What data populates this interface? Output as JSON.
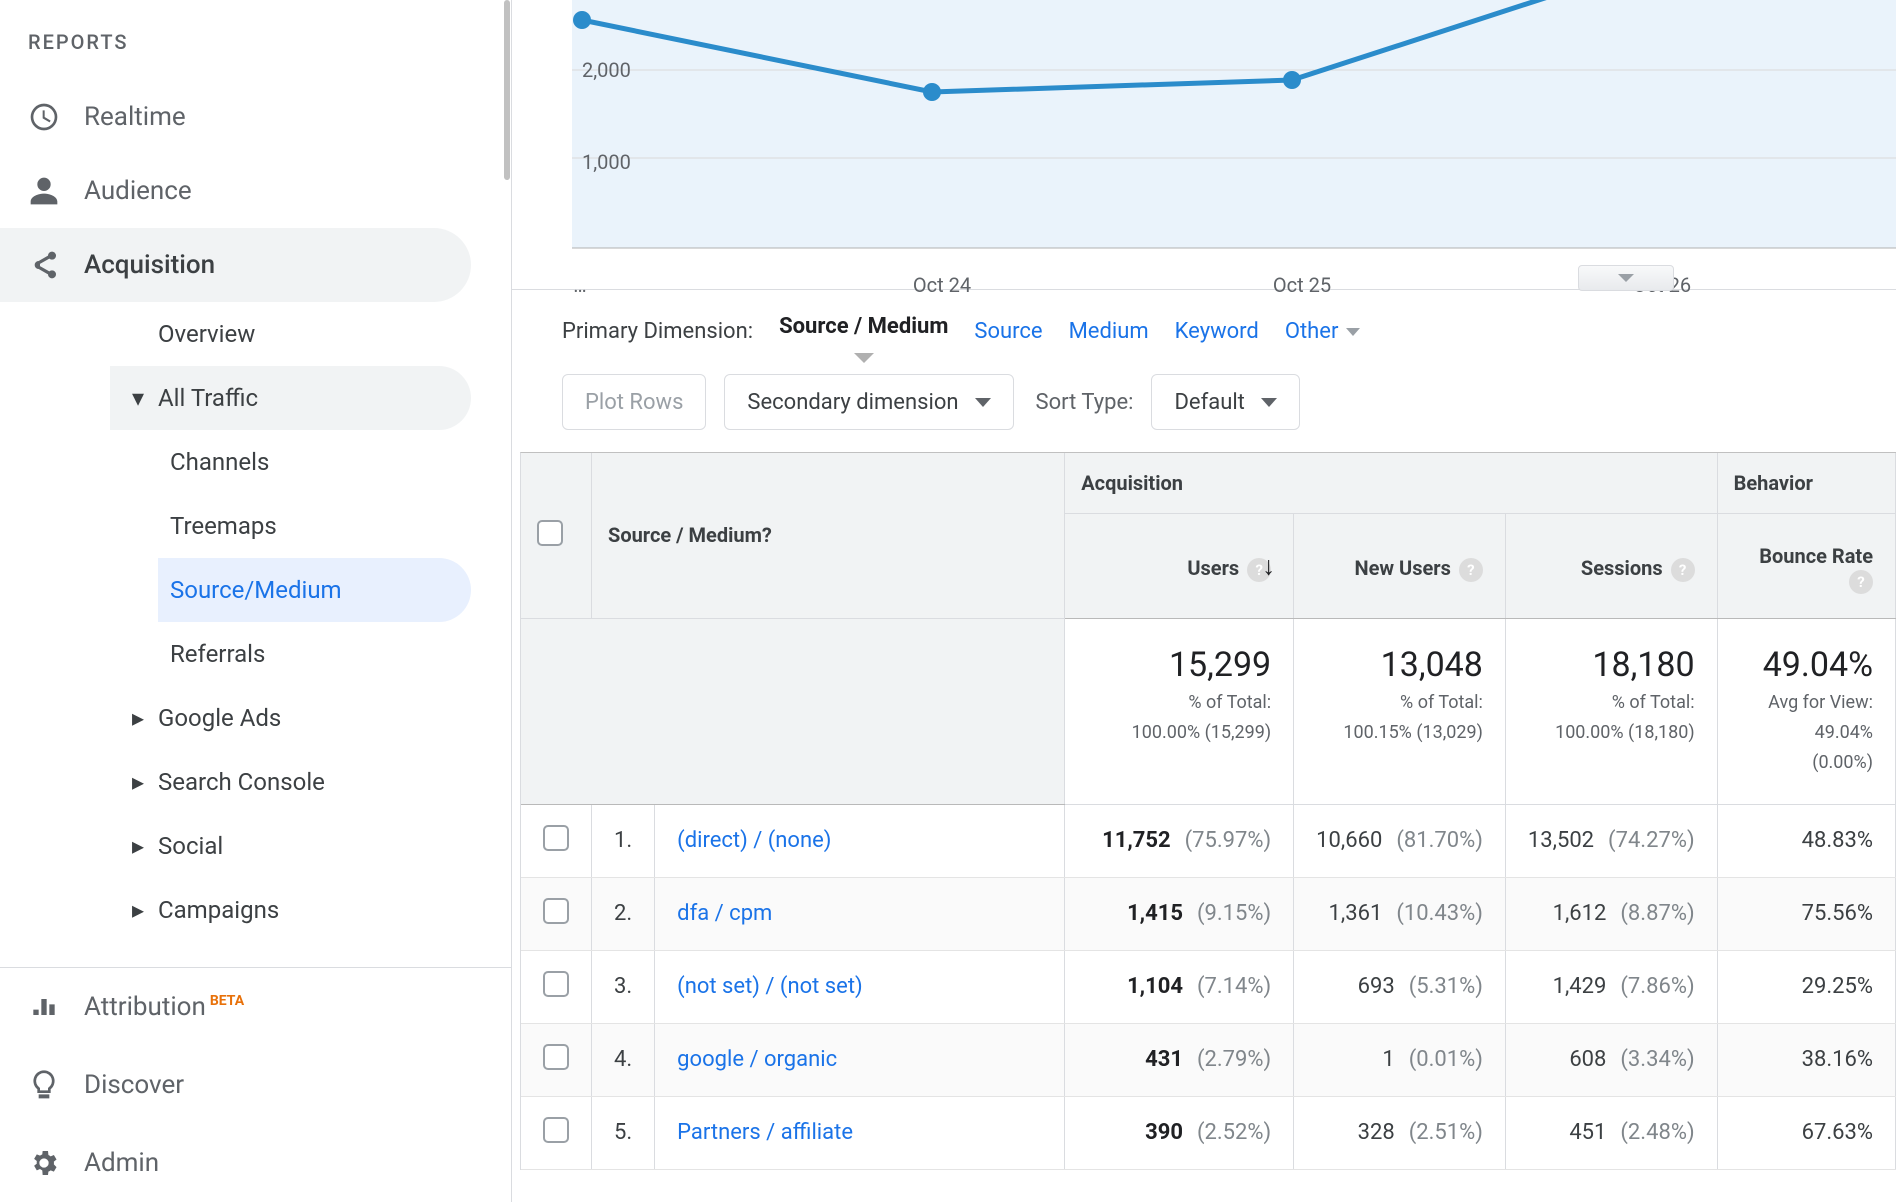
{
  "sidebar": {
    "section": "REPORTS",
    "items": [
      {
        "id": "realtime",
        "label": "Realtime"
      },
      {
        "id": "audience",
        "label": "Audience"
      },
      {
        "id": "acquisition",
        "label": "Acquisition"
      }
    ],
    "acq_children": [
      {
        "id": "overview",
        "label": "Overview"
      },
      {
        "id": "all-traffic",
        "label": "All Traffic",
        "expanded": true
      }
    ],
    "traffic_children": [
      {
        "id": "channels",
        "label": "Channels"
      },
      {
        "id": "treemaps",
        "label": "Treemaps"
      },
      {
        "id": "sourcemed",
        "label": "Source/Medium",
        "active": true
      },
      {
        "id": "referrals",
        "label": "Referrals"
      }
    ],
    "acq_more": [
      {
        "id": "gads",
        "label": "Google Ads"
      },
      {
        "id": "sconsole",
        "label": "Search Console"
      },
      {
        "id": "social",
        "label": "Social"
      },
      {
        "id": "camp",
        "label": "Campaigns"
      }
    ],
    "bottom": [
      {
        "id": "attribution",
        "label": "Attribution",
        "beta": "BETA"
      },
      {
        "id": "discover",
        "label": "Discover"
      },
      {
        "id": "admin",
        "label": "Admin"
      }
    ]
  },
  "chart_data": {
    "type": "line",
    "ylabel": "",
    "ylim": [
      0,
      3000
    ],
    "y_ticks": [
      1000,
      2000
    ],
    "series": [
      {
        "name": "Users",
        "color": "#1a73e8",
        "x": [
          "…",
          "Oct 24",
          "Oct 25",
          "Oct 26"
        ],
        "values": [
          2300,
          1750,
          1800,
          3000
        ]
      }
    ]
  },
  "dimension": {
    "label": "Primary Dimension:",
    "selected": "Source / Medium",
    "options": [
      "Source",
      "Medium",
      "Keyword",
      "Other"
    ]
  },
  "controls": {
    "plot_rows": "Plot Rows",
    "secondary": "Secondary dimension",
    "sort_label": "Sort Type:",
    "sort_value": "Default"
  },
  "table": {
    "col_source": "Source / Medium",
    "group_acq": "Acquisition",
    "group_beh": "Behavior",
    "col_users": "Users",
    "col_new": "New Users",
    "col_sess": "Sessions",
    "col_bounce": "Bounce Rate",
    "totals": {
      "users": {
        "v": "15,299",
        "sub1": "% of Total:",
        "sub2": "100.00% (15,299)"
      },
      "newusers": {
        "v": "13,048",
        "sub1": "% of Total:",
        "sub2": "100.15% (13,029)"
      },
      "sessions": {
        "v": "18,180",
        "sub1": "% of Total:",
        "sub2": "100.00% (18,180)"
      },
      "bounce": {
        "v": "49.04%",
        "sub1": "Avg for View:",
        "sub2": "49.04%",
        "sub3": "(0.00%)"
      }
    },
    "rows": [
      {
        "i": "1.",
        "name": "(direct) / (none)",
        "u": "11,752",
        "up": "(75.97%)",
        "n": "10,660",
        "np": "(81.70%)",
        "s": "13,502",
        "sp": "(74.27%)",
        "b": "48.83%"
      },
      {
        "i": "2.",
        "name": "dfa / cpm",
        "u": "1,415",
        "up": "(9.15%)",
        "n": "1,361",
        "np": "(10.43%)",
        "s": "1,612",
        "sp": "(8.87%)",
        "b": "75.56%"
      },
      {
        "i": "3.",
        "name": "(not set) / (not set)",
        "u": "1,104",
        "up": "(7.14%)",
        "n": "693",
        "np": "(5.31%)",
        "s": "1,429",
        "sp": "(7.86%)",
        "b": "29.25%"
      },
      {
        "i": "4.",
        "name": "google / organic",
        "u": "431",
        "up": "(2.79%)",
        "n": "1",
        "np": "(0.01%)",
        "s": "608",
        "sp": "(3.34%)",
        "b": "38.16%"
      },
      {
        "i": "5.",
        "name": "Partners / affiliate",
        "u": "390",
        "up": "(2.52%)",
        "n": "328",
        "np": "(2.51%)",
        "s": "451",
        "sp": "(2.48%)",
        "b": "67.63%"
      }
    ]
  }
}
